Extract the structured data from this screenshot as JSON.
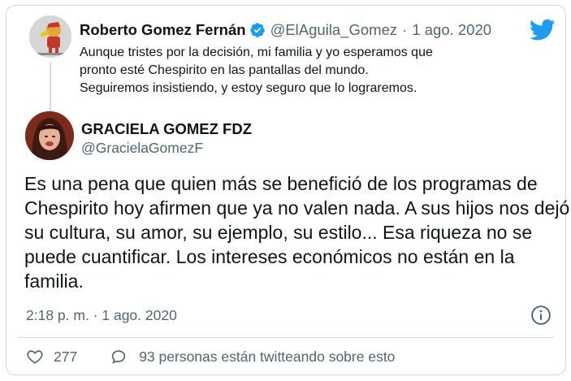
{
  "quoted_tweet": {
    "author_name": "Roberto Gomez Fernán",
    "handle": "@ElAguila_Gomez",
    "separator": "·",
    "date": "1 ago. 2020",
    "text": "Aunque tristes por la decisión, mi familia y yo esperamos que pronto esté Chespirito en las pantallas del mundo. Seguiremos insistiendo, y estoy seguro que lo lograremos."
  },
  "tweet": {
    "author_name": "GRACIELA GOMEZ FDZ",
    "handle": "@GracielaGomezF",
    "text": "Es una pena que quien más se benefició de los programas de Chespirito hoy afirmen que ya no valen nada.  A sus hijos nos dejó su cultura, su amor, su ejemplo, su estilo... Esa riqueza no se puede cuantificar.  Los intereses económicos no están en la familia.",
    "timestamp": "2:18 p. m. · 1 ago. 2020"
  },
  "actions": {
    "like_count": "277",
    "reply_text": "93 personas están twitteando sobre esto"
  },
  "colors": {
    "twitter_blue": "#1d9bf0",
    "text_primary": "#0f1419",
    "text_secondary": "#536471",
    "border": "#cfd9de"
  },
  "icons": [
    "verified-badge-icon",
    "twitter-bird-icon",
    "info-icon",
    "heart-icon",
    "speech-bubble-icon"
  ]
}
